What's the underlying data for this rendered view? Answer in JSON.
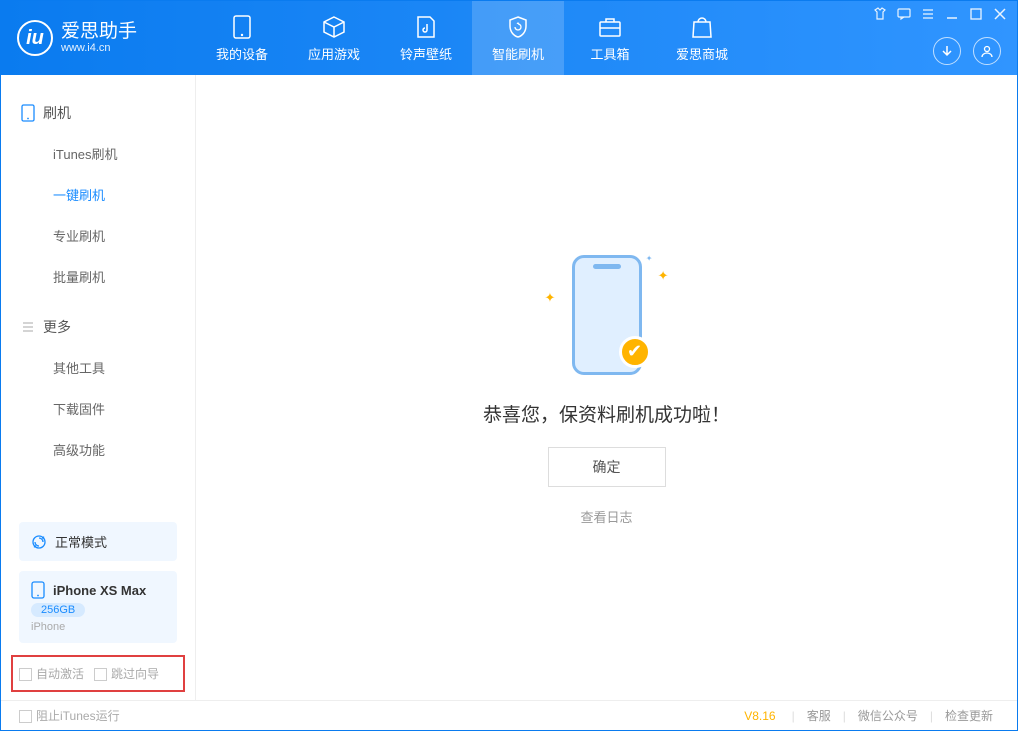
{
  "app": {
    "name": "爱思助手",
    "url": "www.i4.cn"
  },
  "nav": {
    "device": "我的设备",
    "apps": "应用游戏",
    "ringtone": "铃声壁纸",
    "flash": "智能刷机",
    "toolbox": "工具箱",
    "store": "爱思商城"
  },
  "sidebar": {
    "section1": {
      "title": "刷机",
      "items": [
        "iTunes刷机",
        "一键刷机",
        "专业刷机",
        "批量刷机"
      ]
    },
    "section2": {
      "title": "更多",
      "items": [
        "其他工具",
        "下载固件",
        "高级功能"
      ]
    },
    "mode": "正常模式",
    "device": {
      "name": "iPhone XS Max",
      "storage": "256GB",
      "type": "iPhone"
    },
    "opt_activate": "自动激活",
    "opt_skip": "跳过向导"
  },
  "main": {
    "success": "恭喜您，保资料刷机成功啦！",
    "confirm": "确定",
    "view_log": "查看日志"
  },
  "footer": {
    "block_itunes": "阻止iTunes运行",
    "version": "V8.16",
    "support": "客服",
    "wechat": "微信公众号",
    "update": "检查更新"
  }
}
